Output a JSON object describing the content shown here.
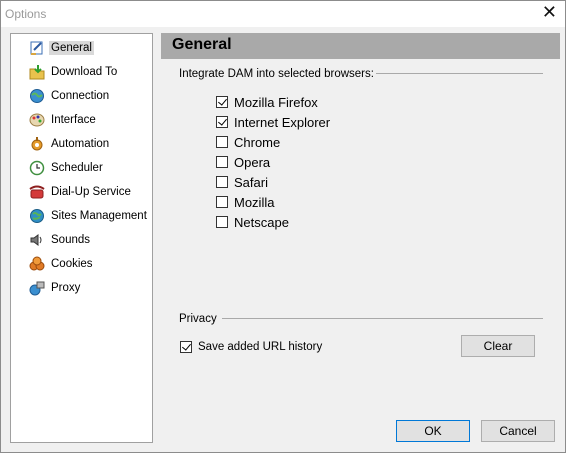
{
  "window": {
    "title": "Options",
    "close_glyph": "✕"
  },
  "sidebar": {
    "items": [
      {
        "label": "General",
        "icon": "general-icon",
        "selected": true
      },
      {
        "label": "Download To",
        "icon": "folder-download-icon"
      },
      {
        "label": "Connection",
        "icon": "globe-connection-icon"
      },
      {
        "label": "Interface",
        "icon": "palette-icon"
      },
      {
        "label": "Automation",
        "icon": "gear-automation-icon"
      },
      {
        "label": "Scheduler",
        "icon": "clock-icon"
      },
      {
        "label": "Dial-Up Service",
        "icon": "phone-icon"
      },
      {
        "label": "Sites Management",
        "icon": "globe-sites-icon"
      },
      {
        "label": "Sounds",
        "icon": "speaker-icon"
      },
      {
        "label": "Cookies",
        "icon": "cookies-icon"
      },
      {
        "label": "Proxy",
        "icon": "proxy-icon"
      }
    ]
  },
  "main": {
    "title": "General",
    "browsers_group_label": "Integrate DAM into selected browsers:",
    "browsers": [
      {
        "label": "Mozilla Firefox",
        "checked": true
      },
      {
        "label": "Internet Explorer",
        "checked": true
      },
      {
        "label": "Chrome",
        "checked": false
      },
      {
        "label": "Opera",
        "checked": false
      },
      {
        "label": "Safari",
        "checked": false
      },
      {
        "label": "Mozilla",
        "checked": false
      },
      {
        "label": "Netscape",
        "checked": false
      }
    ],
    "privacy_group_label": "Privacy",
    "privacy": {
      "save_history_label": "Save added URL history",
      "save_history_checked": true,
      "clear_label": "Clear"
    }
  },
  "footer": {
    "ok_label": "OK",
    "cancel_label": "Cancel"
  }
}
